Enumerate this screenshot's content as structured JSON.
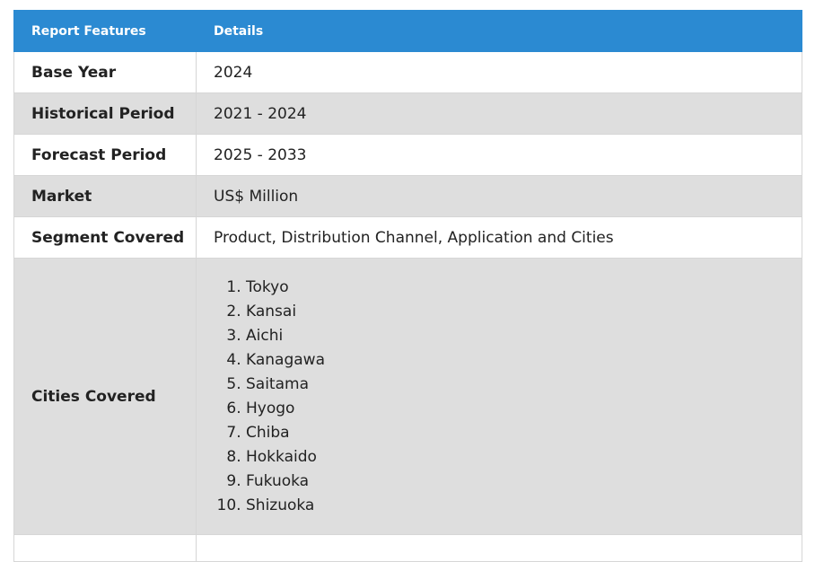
{
  "table": {
    "headers": [
      "Report Features",
      "Details"
    ],
    "rows": [
      {
        "feature": "Base Year",
        "details": "2024"
      },
      {
        "feature": "Historical Period",
        "details": "2021 - 2024"
      },
      {
        "feature": "Forecast Period",
        "details": "2025 - 2033"
      },
      {
        "feature": "Market",
        "details": "US$ Million"
      },
      {
        "feature": "Segment Covered",
        "details": "Product, Distribution Channel, Application and Cities"
      }
    ],
    "cities": {
      "feature": "Cities Covered",
      "list": [
        "Tokyo",
        "Kansai",
        "Aichi",
        "Kanagawa",
        "Saitama",
        "Hyogo",
        "Chiba",
        "Hokkaido",
        "Fukuoka",
        "Shizuoka"
      ]
    }
  },
  "colors": {
    "header_background": "#2b8ad2",
    "alt_row_background": "#dedede"
  }
}
